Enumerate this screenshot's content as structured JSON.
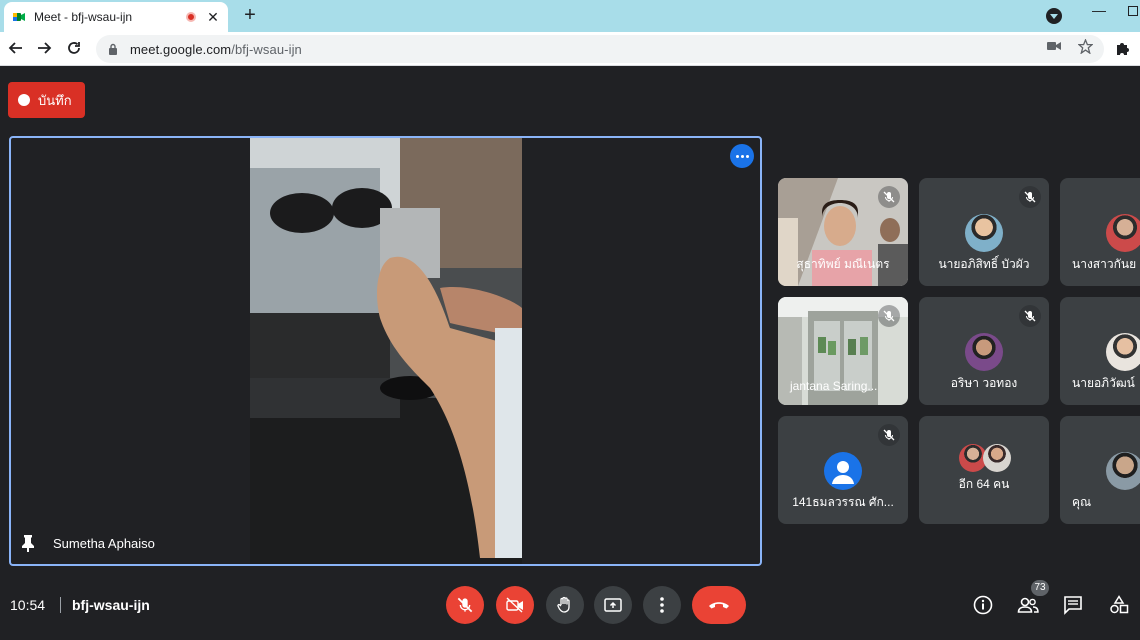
{
  "browser": {
    "tab_title": "Meet - bfj-wsau-ijn",
    "tab_close": "✕",
    "new_tab": "+",
    "url_host": "meet.google.com",
    "url_path": "/bfj-wsau-ijn",
    "minimize": "—",
    "favicon_color": "#00832d"
  },
  "record": {
    "label": "บันทึก",
    "color": "#d93025"
  },
  "main_tile": {
    "speaker": "Sumetha Aphaiso",
    "highlight_color": "#8ab4f8"
  },
  "participants": [
    {
      "name": "สุธาทิพย์ มณีเนตร",
      "muted": true,
      "kind": "video"
    },
    {
      "name": "นายอภิสิทธิ์ บัวผัว",
      "muted": true,
      "kind": "avatar"
    },
    {
      "name": "นางสาวกันย",
      "muted": false,
      "kind": "avatar"
    },
    {
      "name": "jantana Saring...",
      "muted": true,
      "kind": "video"
    },
    {
      "name": "อริษา วอทอง",
      "muted": true,
      "kind": "avatar"
    },
    {
      "name": "นายอภิวัฒน์",
      "muted": false,
      "kind": "avatar"
    },
    {
      "name": "141ธมลวรรณ ศัก...",
      "muted": true,
      "kind": "avatar-initial"
    },
    {
      "name": "อีก 64 คน",
      "muted": false,
      "kind": "more"
    },
    {
      "name": "คุณ",
      "muted": false,
      "kind": "avatar"
    }
  ],
  "bottom_bar": {
    "time": "10:54",
    "meeting_code": "bfj-wsau-ijn",
    "people_count": "73"
  },
  "icons": {
    "mic_off": "mic-off-icon",
    "camera_off": "camera-off-icon",
    "raise_hand": "hand-icon",
    "present": "present-screen-icon",
    "more": "more-vert-icon",
    "hang_up": "call-end-icon",
    "info": "info-icon",
    "people": "people-icon",
    "chat": "chat-icon",
    "activities": "activities-icon"
  }
}
